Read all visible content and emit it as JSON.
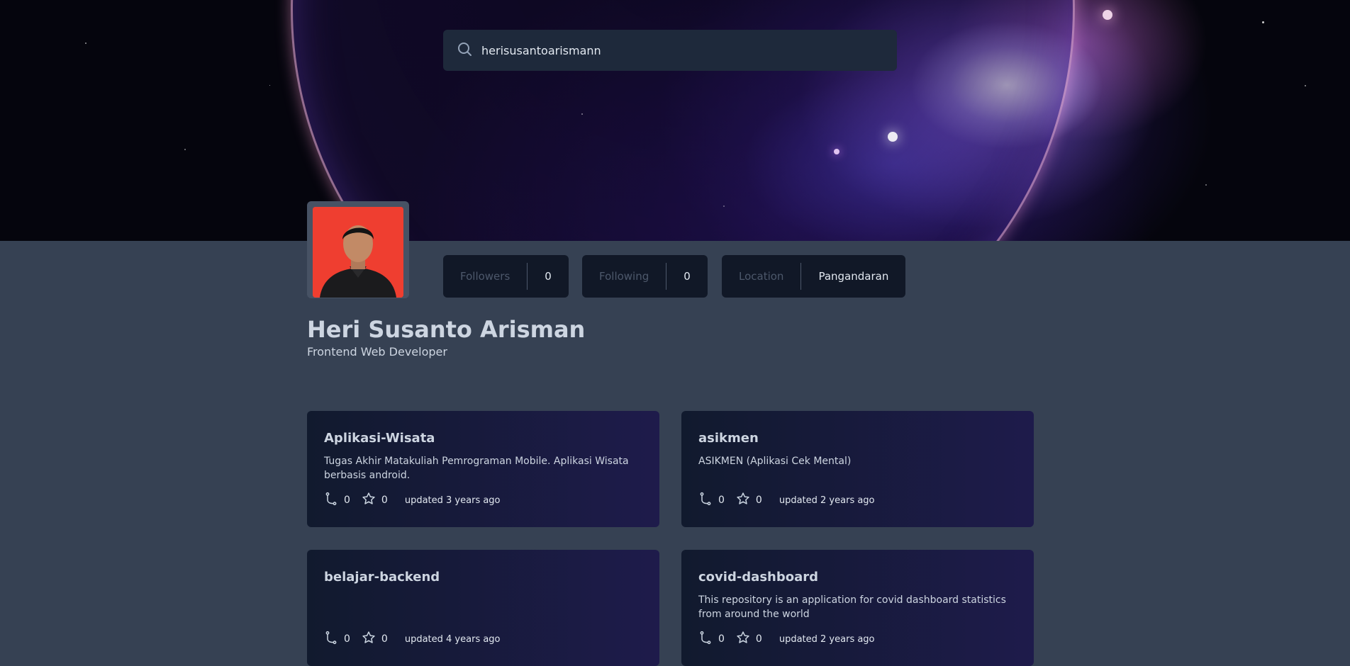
{
  "search": {
    "value": "herisusantoarismann",
    "placeholder": "Search GitHub username"
  },
  "profile": {
    "name": "Heri Susanto Arisman",
    "bio": "Frontend Web Developer",
    "stats": [
      {
        "label": "Followers",
        "value": "0"
      },
      {
        "label": "Following",
        "value": "0"
      },
      {
        "label": "Location",
        "value": "Pangandaran"
      }
    ]
  },
  "repos": [
    {
      "name": "Aplikasi-Wisata",
      "description": "Tugas Akhir Matakuliah Pemrograman Mobile. Aplikasi Wisata berbasis android.",
      "forks": "0",
      "stars": "0",
      "updated": "updated 3 years ago"
    },
    {
      "name": "asikmen",
      "description": "ASIKMEN (Aplikasi Cek Mental)",
      "forks": "0",
      "stars": "0",
      "updated": "updated 2 years ago"
    },
    {
      "name": "belajar-backend",
      "description": "",
      "forks": "0",
      "stars": "0",
      "updated": "updated 4 years ago"
    },
    {
      "name": "covid-dashboard",
      "description": "This repository is an application for covid dashboard statistics from around the world",
      "forks": "0",
      "stars": "0",
      "updated": "updated 2 years ago"
    }
  ],
  "icons": {
    "search": "search-icon",
    "fork": "fork-icon",
    "star": "star-icon"
  },
  "colors": {
    "page_bg": "#364153",
    "panel_bg": "#111827",
    "search_bg": "#1e293b",
    "avatar_bg": "#ef3e30"
  }
}
